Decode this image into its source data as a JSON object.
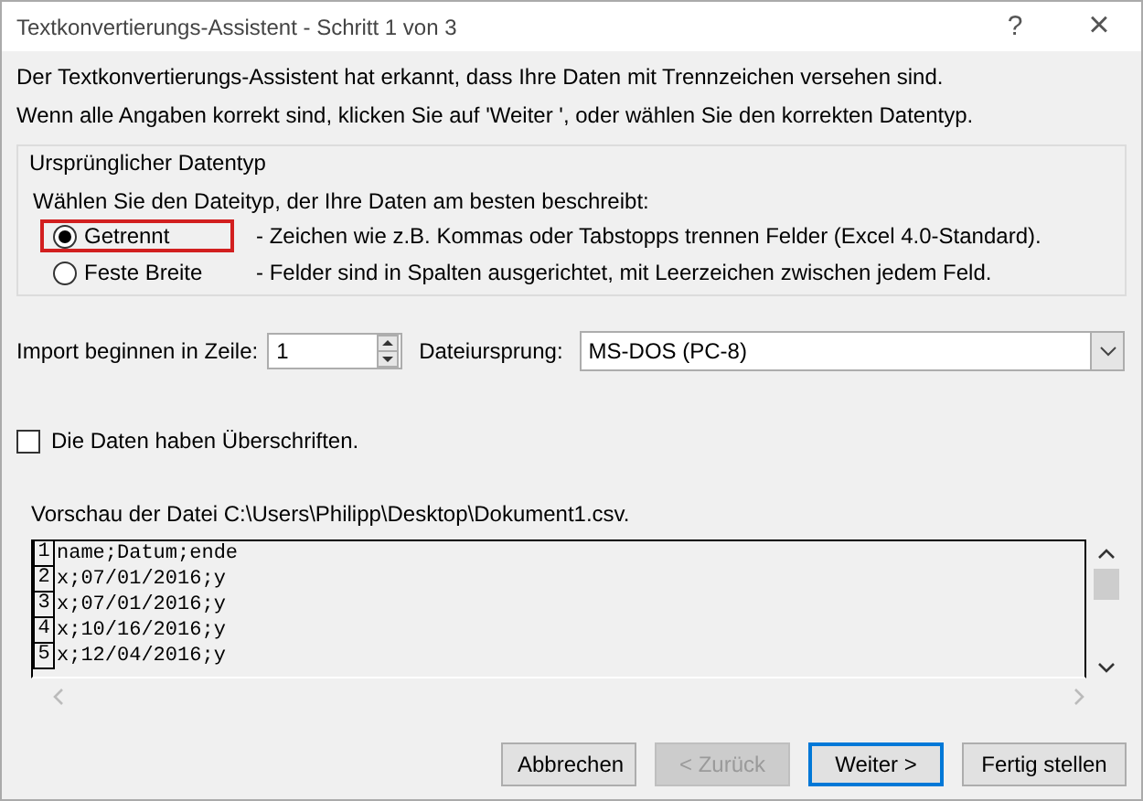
{
  "window": {
    "title": "Textkonvertierungs-Assistent - Schritt 1 von 3",
    "help": "?",
    "close": "×"
  },
  "intro": [
    "Der Textkonvertierungs-Assistent hat erkannt, dass Ihre Daten mit Trennzeichen versehen sind.",
    "Wenn alle Angaben korrekt sind, klicken Sie auf 'Weiter ', oder wählen Sie den korrekten Datentyp."
  ],
  "datatype": {
    "legend": "Ursprünglicher Datentyp",
    "prompt": "Wählen Sie den Dateityp, der Ihre Daten am besten beschreibt:",
    "options": [
      {
        "label": "Getrennt",
        "description": "- Zeichen wie z.B. Kommas oder Tabstopps trennen Felder (Excel 4.0-Standard).",
        "selected": true,
        "highlighted": true
      },
      {
        "label": "Feste Breite",
        "description": "- Felder sind in Spalten ausgerichtet, mit Leerzeichen zwischen jedem Feld.",
        "selected": false,
        "highlighted": false
      }
    ]
  },
  "start_row": {
    "label": "Import beginnen in Zeile:",
    "value": "1"
  },
  "origin": {
    "label": "Dateiursprung:",
    "value": "MS-DOS (PC-8)"
  },
  "headers": {
    "label": "Die Daten haben Überschriften.",
    "checked": false
  },
  "preview": {
    "label": "Vorschau der Datei C:\\Users\\Philipp\\Desktop\\Dokument1.csv.",
    "rows": [
      {
        "number": "1",
        "text": "name;Datum;ende"
      },
      {
        "number": "2",
        "text": "x;07/01/2016;y"
      },
      {
        "number": "3",
        "text": "x;07/01/2016;y"
      },
      {
        "number": "4",
        "text": "x;10/16/2016;y"
      },
      {
        "number": "5",
        "text": "x;12/04/2016;y"
      }
    ]
  },
  "buttons": [
    {
      "label": "Abbrechen",
      "disabled": false,
      "default": false
    },
    {
      "label": "< Zurück",
      "disabled": true,
      "default": false
    },
    {
      "label": "Weiter >",
      "disabled": false,
      "default": true
    },
    {
      "label": "Fertig stellen",
      "disabled": false,
      "default": false
    }
  ]
}
